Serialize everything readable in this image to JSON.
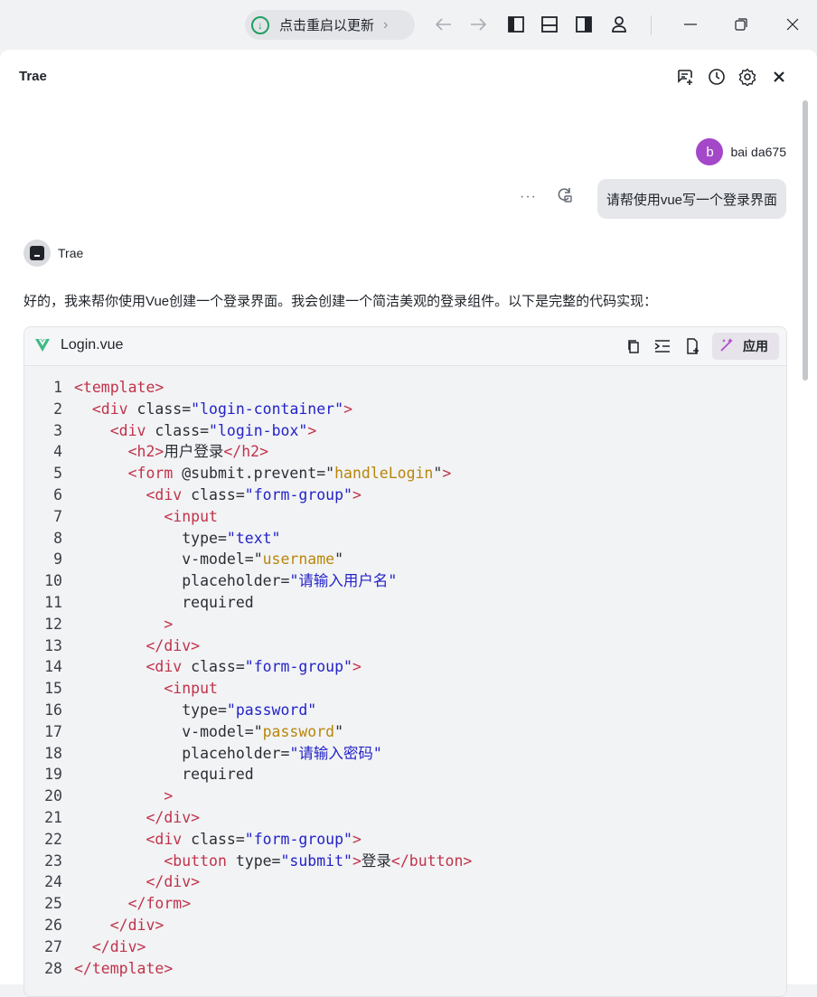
{
  "titlebar": {
    "update_label": "点击重启以更新",
    "icons": [
      "download-icon",
      "chevron-right-icon",
      "back-arrow-icon",
      "forward-arrow-icon",
      "left-panel-icon",
      "bottom-panel-icon",
      "right-panel-icon",
      "account-icon",
      "minimize-icon",
      "restore-icon",
      "close-icon"
    ]
  },
  "panel": {
    "title": "Trae",
    "header_icons": [
      "new-chat-icon",
      "history-icon",
      "gear-icon",
      "close-icon"
    ]
  },
  "user": {
    "avatar_letter": "b",
    "name": "bai da675",
    "message": "请帮使用vue写一个登录界面",
    "more_label": "···"
  },
  "assistant": {
    "name": "Trae",
    "intro": "好的，我来帮你使用Vue创建一个登录界面。我会创建一个简洁美观的登录组件。以下是完整的代码实现："
  },
  "code_block": {
    "filename": "Login.vue",
    "apply_label": "应用",
    "lines": [
      {
        "n": "1",
        "tokens": [
          [
            "t-tag",
            "<template>"
          ]
        ]
      },
      {
        "n": "2",
        "tokens": [
          [
            "t-txt",
            "  "
          ],
          [
            "t-tag",
            "<div"
          ],
          [
            "t-attr",
            " class="
          ],
          [
            "t-str",
            "\"login-container\""
          ],
          [
            "t-tag",
            ">"
          ]
        ]
      },
      {
        "n": "3",
        "tokens": [
          [
            "t-txt",
            "    "
          ],
          [
            "t-tag",
            "<div"
          ],
          [
            "t-attr",
            " class="
          ],
          [
            "t-str",
            "\"login-box\""
          ],
          [
            "t-tag",
            ">"
          ]
        ]
      },
      {
        "n": "4",
        "tokens": [
          [
            "t-txt",
            "      "
          ],
          [
            "t-tag",
            "<h2>"
          ],
          [
            "t-txt",
            "用户登录"
          ],
          [
            "t-tag",
            "</h2>"
          ]
        ]
      },
      {
        "n": "5",
        "tokens": [
          [
            "t-txt",
            "      "
          ],
          [
            "t-tag",
            "<form"
          ],
          [
            "t-attr",
            " @submit.prevent=\""
          ],
          [
            "t-fn",
            "handleLogin"
          ],
          [
            "t-attr",
            "\""
          ],
          [
            "t-tag",
            ">"
          ]
        ]
      },
      {
        "n": "6",
        "tokens": [
          [
            "t-txt",
            "        "
          ],
          [
            "t-tag",
            "<div"
          ],
          [
            "t-attr",
            " class="
          ],
          [
            "t-str",
            "\"form-group\""
          ],
          [
            "t-tag",
            ">"
          ]
        ]
      },
      {
        "n": "7",
        "tokens": [
          [
            "t-txt",
            "          "
          ],
          [
            "t-tag",
            "<input"
          ]
        ]
      },
      {
        "n": "8",
        "tokens": [
          [
            "t-txt",
            "            "
          ],
          [
            "t-attr",
            "type="
          ],
          [
            "t-str",
            "\"text\""
          ]
        ]
      },
      {
        "n": "9",
        "tokens": [
          [
            "t-txt",
            "            "
          ],
          [
            "t-attr",
            "v-model=\""
          ],
          [
            "t-fn",
            "username"
          ],
          [
            "t-attr",
            "\""
          ]
        ]
      },
      {
        "n": "10",
        "tokens": [
          [
            "t-txt",
            "            "
          ],
          [
            "t-attr",
            "placeholder="
          ],
          [
            "t-str",
            "\"请输入用户名\""
          ]
        ]
      },
      {
        "n": "11",
        "tokens": [
          [
            "t-txt",
            "            "
          ],
          [
            "t-attr",
            "required"
          ]
        ]
      },
      {
        "n": "12",
        "tokens": [
          [
            "t-txt",
            "          "
          ],
          [
            "t-tag",
            ">"
          ]
        ]
      },
      {
        "n": "13",
        "tokens": [
          [
            "t-txt",
            "        "
          ],
          [
            "t-tag",
            "</div>"
          ]
        ]
      },
      {
        "n": "14",
        "tokens": [
          [
            "t-txt",
            "        "
          ],
          [
            "t-tag",
            "<div"
          ],
          [
            "t-attr",
            " class="
          ],
          [
            "t-str",
            "\"form-group\""
          ],
          [
            "t-tag",
            ">"
          ]
        ]
      },
      {
        "n": "15",
        "tokens": [
          [
            "t-txt",
            "          "
          ],
          [
            "t-tag",
            "<input"
          ]
        ]
      },
      {
        "n": "16",
        "tokens": [
          [
            "t-txt",
            "            "
          ],
          [
            "t-attr",
            "type="
          ],
          [
            "t-str",
            "\"password\""
          ]
        ]
      },
      {
        "n": "17",
        "tokens": [
          [
            "t-txt",
            "            "
          ],
          [
            "t-attr",
            "v-model=\""
          ],
          [
            "t-fn",
            "password"
          ],
          [
            "t-attr",
            "\""
          ]
        ]
      },
      {
        "n": "18",
        "tokens": [
          [
            "t-txt",
            "            "
          ],
          [
            "t-attr",
            "placeholder="
          ],
          [
            "t-str",
            "\"请输入密码\""
          ]
        ]
      },
      {
        "n": "19",
        "tokens": [
          [
            "t-txt",
            "            "
          ],
          [
            "t-attr",
            "required"
          ]
        ]
      },
      {
        "n": "20",
        "tokens": [
          [
            "t-txt",
            "          "
          ],
          [
            "t-tag",
            ">"
          ]
        ]
      },
      {
        "n": "21",
        "tokens": [
          [
            "t-txt",
            "        "
          ],
          [
            "t-tag",
            "</div>"
          ]
        ]
      },
      {
        "n": "22",
        "tokens": [
          [
            "t-txt",
            "        "
          ],
          [
            "t-tag",
            "<div"
          ],
          [
            "t-attr",
            " class="
          ],
          [
            "t-str",
            "\"form-group\""
          ],
          [
            "t-tag",
            ">"
          ]
        ]
      },
      {
        "n": "23",
        "tokens": [
          [
            "t-txt",
            "          "
          ],
          [
            "t-tag",
            "<button"
          ],
          [
            "t-attr",
            " type="
          ],
          [
            "t-str",
            "\"submit\""
          ],
          [
            "t-tag",
            ">"
          ],
          [
            "t-txt",
            "登录"
          ],
          [
            "t-tag",
            "</button>"
          ]
        ]
      },
      {
        "n": "24",
        "tokens": [
          [
            "t-txt",
            "        "
          ],
          [
            "t-tag",
            "</div>"
          ]
        ]
      },
      {
        "n": "25",
        "tokens": [
          [
            "t-txt",
            "      "
          ],
          [
            "t-tag",
            "</form>"
          ]
        ]
      },
      {
        "n": "26",
        "tokens": [
          [
            "t-txt",
            "    "
          ],
          [
            "t-tag",
            "</div>"
          ]
        ]
      },
      {
        "n": "27",
        "tokens": [
          [
            "t-txt",
            "  "
          ],
          [
            "t-tag",
            "</div>"
          ]
        ]
      },
      {
        "n": "28",
        "tokens": [
          [
            "t-tag",
            "</template>"
          ]
        ]
      }
    ]
  },
  "colors": {
    "accent_green": "#20a162",
    "avatar_purple": "#a447c9",
    "tag_red": "#c0334a",
    "string_blue": "#2323c8",
    "value_gold": "#b8860b"
  }
}
